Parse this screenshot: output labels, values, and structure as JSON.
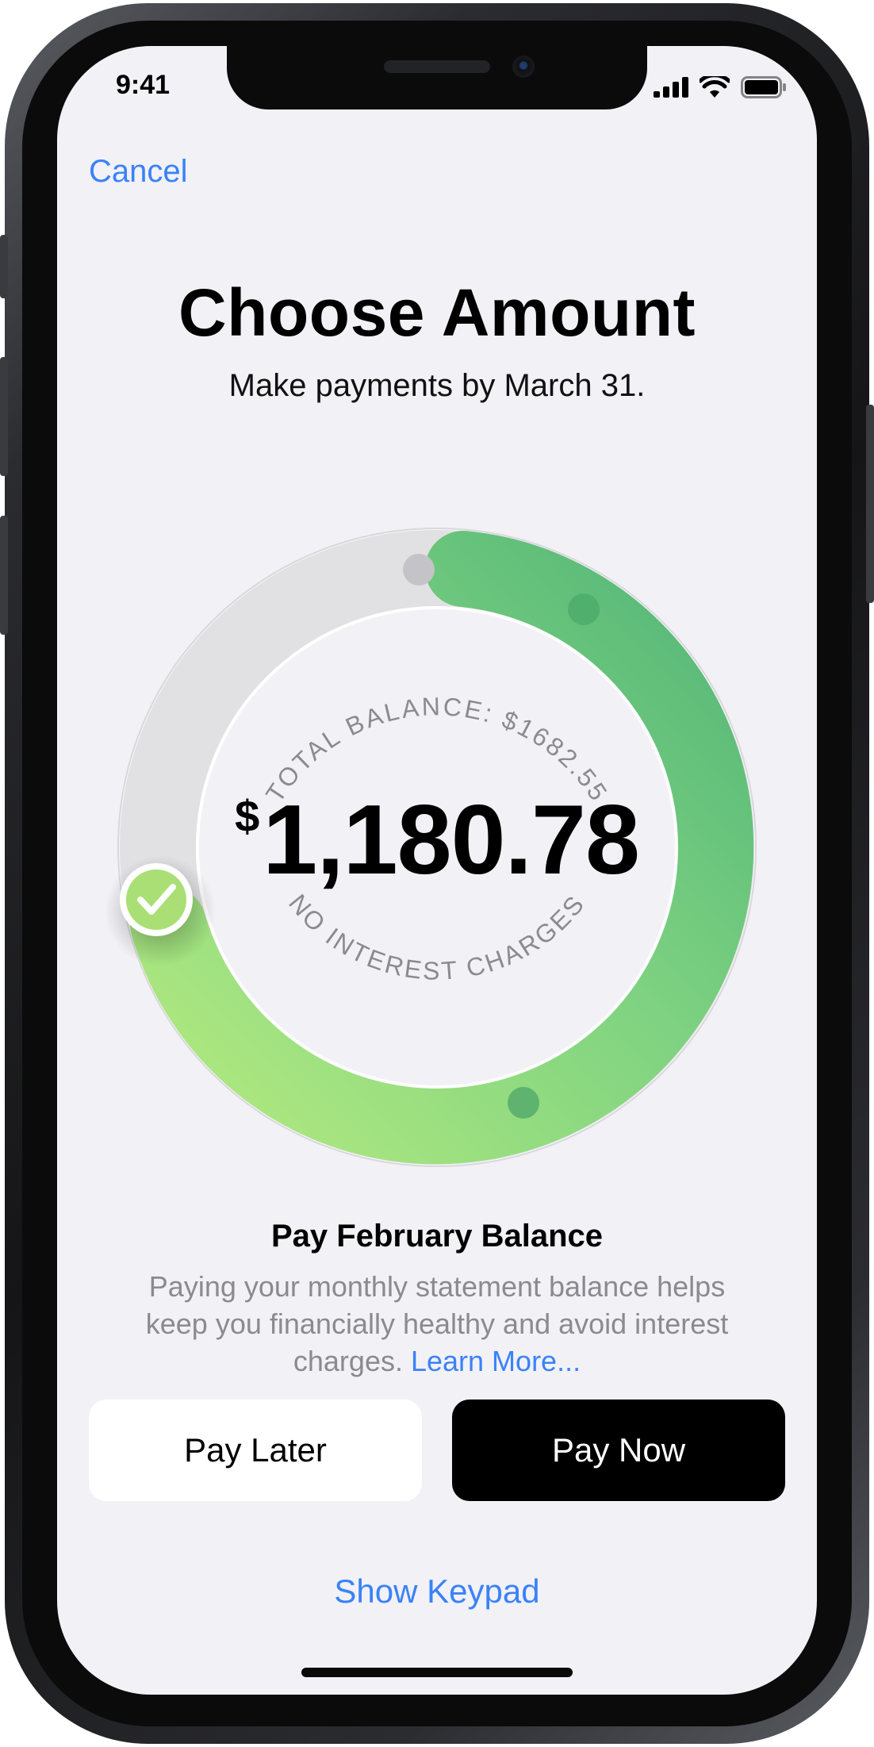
{
  "status_bar": {
    "time": "9:41"
  },
  "nav": {
    "cancel_label": "Cancel"
  },
  "header": {
    "title": "Choose Amount",
    "subtitle": "Make payments by March 31."
  },
  "dial": {
    "total_balance_label": "TOTAL BALANCE: $1682.55",
    "status_label": "NO INTEREST CHARGES",
    "currency_symbol": "$",
    "amount": "1,180.78",
    "total_balance_value": 1682.55,
    "selected_amount_value": 1180.78,
    "colors": {
      "track": "#e0e0e2",
      "green_light": "#aee57a",
      "green_dark": "#57b978",
      "handle": "#a9df74"
    }
  },
  "option": {
    "title": "Pay February Balance",
    "description": "Paying your monthly statement balance helps keep you financially healthy and avoid interest charges.",
    "learn_more": "Learn More..."
  },
  "buttons": {
    "pay_later": "Pay Later",
    "pay_now": "Pay Now"
  },
  "footer": {
    "show_keypad": "Show Keypad"
  },
  "colors": {
    "accent": "#3a82f7",
    "background": "#f1f1f6",
    "primary_button": "#000000"
  }
}
